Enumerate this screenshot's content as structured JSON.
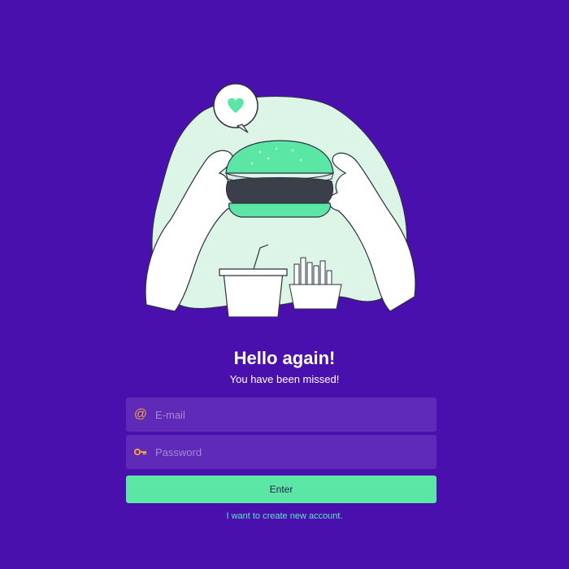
{
  "hero": {
    "title": "Hello again!",
    "subtitle": "You have been missed!"
  },
  "form": {
    "email": {
      "icon": "at-sign-icon",
      "placeholder": "E-mail",
      "value": ""
    },
    "password": {
      "icon": "key-icon",
      "placeholder": "Password",
      "value": ""
    },
    "enter_label": "Enter",
    "create_account_label": "I want to create new account."
  },
  "colors": {
    "background": "#4a10ad",
    "field_background": "#5e2ab7",
    "accent_green": "#5ce6a6",
    "icon_orange": "#f2a43a",
    "illustration_mint": "#dcf5e6"
  }
}
